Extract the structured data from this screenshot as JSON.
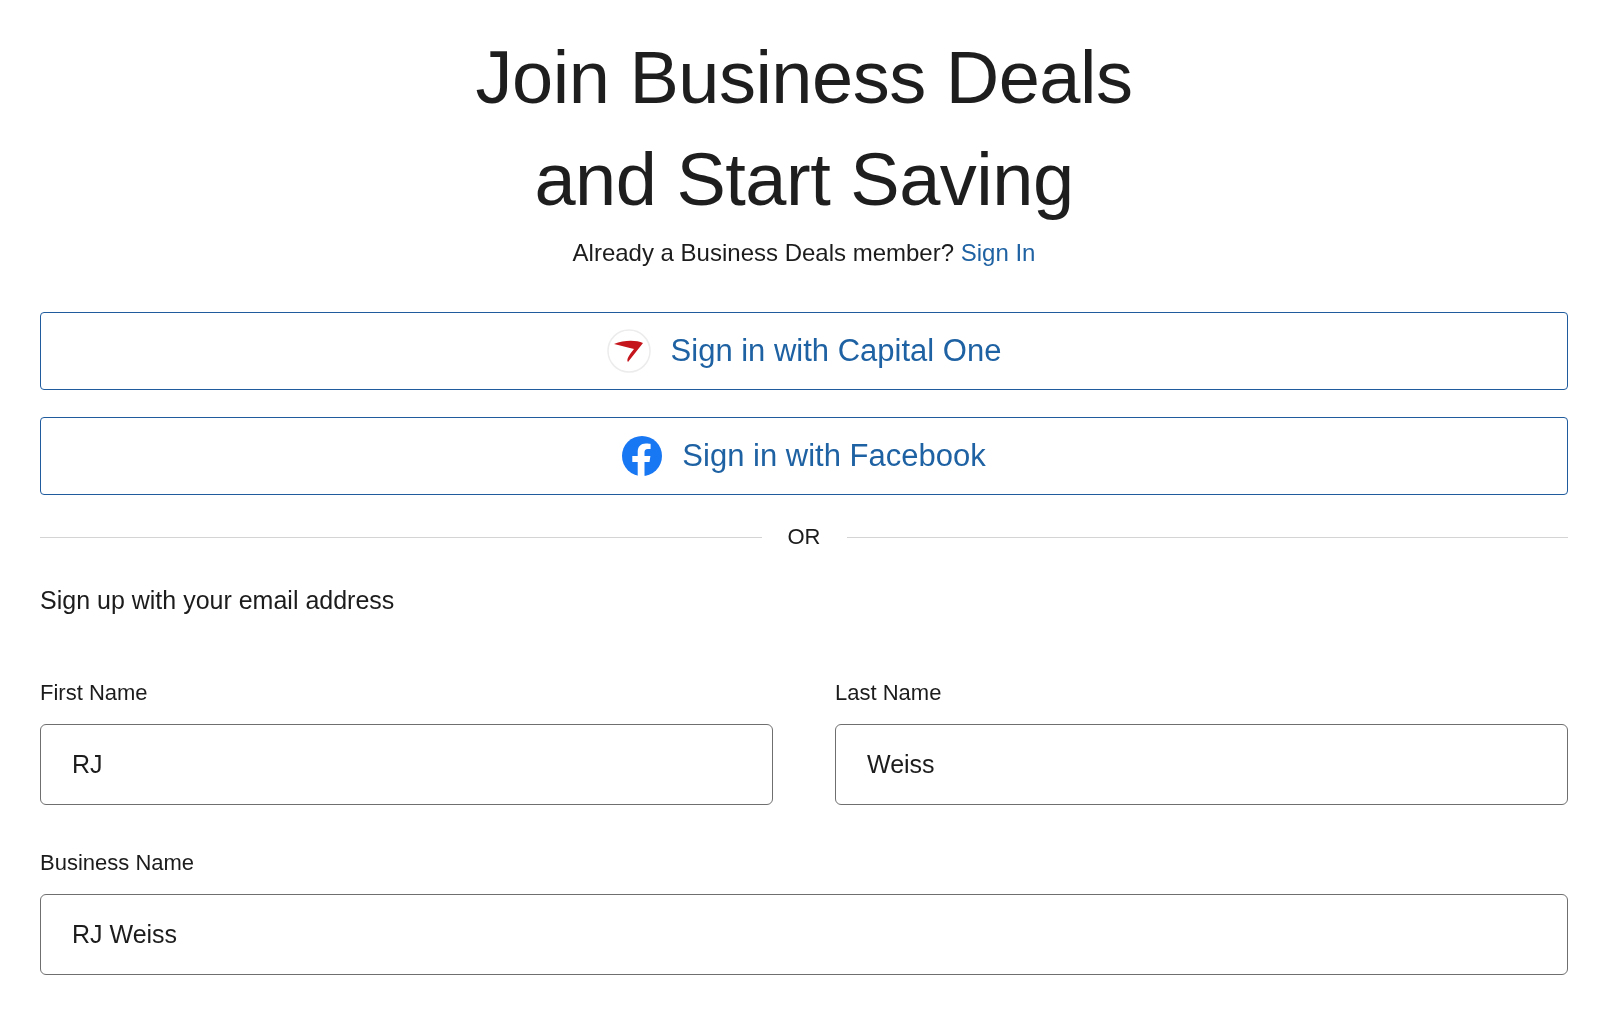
{
  "header": {
    "title_lines": [
      "Join Business Deals",
      "and Start Saving"
    ],
    "prompt": "Already a Business Deals member?",
    "sign_in_link": "Sign In"
  },
  "social_buttons": [
    {
      "kind": "capital-one",
      "label": "Sign in with Capital One"
    },
    {
      "kind": "facebook",
      "label": "Sign in with Facebook"
    }
  ],
  "divider": {
    "label": "OR"
  },
  "form": {
    "intro": "Sign up with your email address",
    "rows": [
      [
        {
          "label": "First Name",
          "value": "RJ"
        },
        {
          "label": "Last Name",
          "value": "Weiss"
        }
      ],
      [
        {
          "label": "Business Name",
          "value": "RJ Weiss"
        }
      ]
    ]
  }
}
